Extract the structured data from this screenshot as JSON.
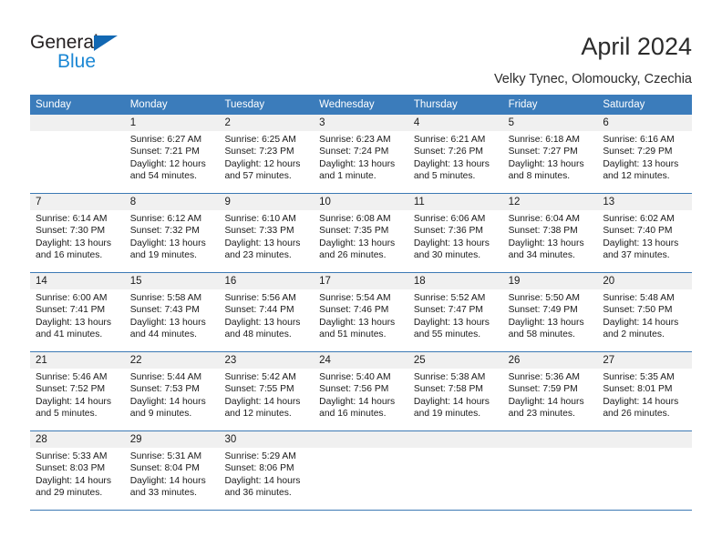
{
  "brand": {
    "name_top": "General",
    "name_bottom": "Blue",
    "accent_blue": "#1268b3",
    "light_blue": "#1b87d4"
  },
  "header": {
    "title": "April 2024",
    "subtitle": "Velky Tynec, Olomoucky, Czechia",
    "header_bg": "#3b7cbb",
    "divider_color": "#3c79b4",
    "daynum_bg": "#f0f0f0"
  },
  "weekdays": [
    "Sunday",
    "Monday",
    "Tuesday",
    "Wednesday",
    "Thursday",
    "Friday",
    "Saturday"
  ],
  "weeks": [
    [
      {
        "day": "",
        "l1": "",
        "l2": "",
        "l3": "",
        "l4": ""
      },
      {
        "day": "1",
        "l1": "Sunrise: 6:27 AM",
        "l2": "Sunset: 7:21 PM",
        "l3": "Daylight: 12 hours",
        "l4": "and 54 minutes."
      },
      {
        "day": "2",
        "l1": "Sunrise: 6:25 AM",
        "l2": "Sunset: 7:23 PM",
        "l3": "Daylight: 12 hours",
        "l4": "and 57 minutes."
      },
      {
        "day": "3",
        "l1": "Sunrise: 6:23 AM",
        "l2": "Sunset: 7:24 PM",
        "l3": "Daylight: 13 hours",
        "l4": "and 1 minute."
      },
      {
        "day": "4",
        "l1": "Sunrise: 6:21 AM",
        "l2": "Sunset: 7:26 PM",
        "l3": "Daylight: 13 hours",
        "l4": "and 5 minutes."
      },
      {
        "day": "5",
        "l1": "Sunrise: 6:18 AM",
        "l2": "Sunset: 7:27 PM",
        "l3": "Daylight: 13 hours",
        "l4": "and 8 minutes."
      },
      {
        "day": "6",
        "l1": "Sunrise: 6:16 AM",
        "l2": "Sunset: 7:29 PM",
        "l3": "Daylight: 13 hours",
        "l4": "and 12 minutes."
      }
    ],
    [
      {
        "day": "7",
        "l1": "Sunrise: 6:14 AM",
        "l2": "Sunset: 7:30 PM",
        "l3": "Daylight: 13 hours",
        "l4": "and 16 minutes."
      },
      {
        "day": "8",
        "l1": "Sunrise: 6:12 AM",
        "l2": "Sunset: 7:32 PM",
        "l3": "Daylight: 13 hours",
        "l4": "and 19 minutes."
      },
      {
        "day": "9",
        "l1": "Sunrise: 6:10 AM",
        "l2": "Sunset: 7:33 PM",
        "l3": "Daylight: 13 hours",
        "l4": "and 23 minutes."
      },
      {
        "day": "10",
        "l1": "Sunrise: 6:08 AM",
        "l2": "Sunset: 7:35 PM",
        "l3": "Daylight: 13 hours",
        "l4": "and 26 minutes."
      },
      {
        "day": "11",
        "l1": "Sunrise: 6:06 AM",
        "l2": "Sunset: 7:36 PM",
        "l3": "Daylight: 13 hours",
        "l4": "and 30 minutes."
      },
      {
        "day": "12",
        "l1": "Sunrise: 6:04 AM",
        "l2": "Sunset: 7:38 PM",
        "l3": "Daylight: 13 hours",
        "l4": "and 34 minutes."
      },
      {
        "day": "13",
        "l1": "Sunrise: 6:02 AM",
        "l2": "Sunset: 7:40 PM",
        "l3": "Daylight: 13 hours",
        "l4": "and 37 minutes."
      }
    ],
    [
      {
        "day": "14",
        "l1": "Sunrise: 6:00 AM",
        "l2": "Sunset: 7:41 PM",
        "l3": "Daylight: 13 hours",
        "l4": "and 41 minutes."
      },
      {
        "day": "15",
        "l1": "Sunrise: 5:58 AM",
        "l2": "Sunset: 7:43 PM",
        "l3": "Daylight: 13 hours",
        "l4": "and 44 minutes."
      },
      {
        "day": "16",
        "l1": "Sunrise: 5:56 AM",
        "l2": "Sunset: 7:44 PM",
        "l3": "Daylight: 13 hours",
        "l4": "and 48 minutes."
      },
      {
        "day": "17",
        "l1": "Sunrise: 5:54 AM",
        "l2": "Sunset: 7:46 PM",
        "l3": "Daylight: 13 hours",
        "l4": "and 51 minutes."
      },
      {
        "day": "18",
        "l1": "Sunrise: 5:52 AM",
        "l2": "Sunset: 7:47 PM",
        "l3": "Daylight: 13 hours",
        "l4": "and 55 minutes."
      },
      {
        "day": "19",
        "l1": "Sunrise: 5:50 AM",
        "l2": "Sunset: 7:49 PM",
        "l3": "Daylight: 13 hours",
        "l4": "and 58 minutes."
      },
      {
        "day": "20",
        "l1": "Sunrise: 5:48 AM",
        "l2": "Sunset: 7:50 PM",
        "l3": "Daylight: 14 hours",
        "l4": "and 2 minutes."
      }
    ],
    [
      {
        "day": "21",
        "l1": "Sunrise: 5:46 AM",
        "l2": "Sunset: 7:52 PM",
        "l3": "Daylight: 14 hours",
        "l4": "and 5 minutes."
      },
      {
        "day": "22",
        "l1": "Sunrise: 5:44 AM",
        "l2": "Sunset: 7:53 PM",
        "l3": "Daylight: 14 hours",
        "l4": "and 9 minutes."
      },
      {
        "day": "23",
        "l1": "Sunrise: 5:42 AM",
        "l2": "Sunset: 7:55 PM",
        "l3": "Daylight: 14 hours",
        "l4": "and 12 minutes."
      },
      {
        "day": "24",
        "l1": "Sunrise: 5:40 AM",
        "l2": "Sunset: 7:56 PM",
        "l3": "Daylight: 14 hours",
        "l4": "and 16 minutes."
      },
      {
        "day": "25",
        "l1": "Sunrise: 5:38 AM",
        "l2": "Sunset: 7:58 PM",
        "l3": "Daylight: 14 hours",
        "l4": "and 19 minutes."
      },
      {
        "day": "26",
        "l1": "Sunrise: 5:36 AM",
        "l2": "Sunset: 7:59 PM",
        "l3": "Daylight: 14 hours",
        "l4": "and 23 minutes."
      },
      {
        "day": "27",
        "l1": "Sunrise: 5:35 AM",
        "l2": "Sunset: 8:01 PM",
        "l3": "Daylight: 14 hours",
        "l4": "and 26 minutes."
      }
    ],
    [
      {
        "day": "28",
        "l1": "Sunrise: 5:33 AM",
        "l2": "Sunset: 8:03 PM",
        "l3": "Daylight: 14 hours",
        "l4": "and 29 minutes."
      },
      {
        "day": "29",
        "l1": "Sunrise: 5:31 AM",
        "l2": "Sunset: 8:04 PM",
        "l3": "Daylight: 14 hours",
        "l4": "and 33 minutes."
      },
      {
        "day": "30",
        "l1": "Sunrise: 5:29 AM",
        "l2": "Sunset: 8:06 PM",
        "l3": "Daylight: 14 hours",
        "l4": "and 36 minutes."
      },
      {
        "day": "",
        "l1": "",
        "l2": "",
        "l3": "",
        "l4": ""
      },
      {
        "day": "",
        "l1": "",
        "l2": "",
        "l3": "",
        "l4": ""
      },
      {
        "day": "",
        "l1": "",
        "l2": "",
        "l3": "",
        "l4": ""
      },
      {
        "day": "",
        "l1": "",
        "l2": "",
        "l3": "",
        "l4": ""
      }
    ]
  ]
}
